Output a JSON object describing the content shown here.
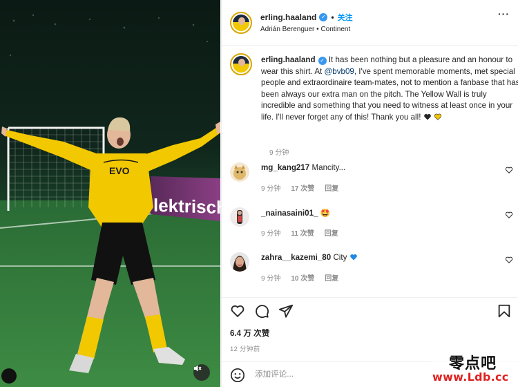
{
  "post": {
    "username": "erling.haaland",
    "follow_label": "关注",
    "dot": "•",
    "subtitle": "Adrián Berenguer • Continent",
    "more": "···"
  },
  "media": {
    "banner_text": "lektrische",
    "shirt_text": "EVO"
  },
  "caption": {
    "username": "erling.haaland",
    "text_before": " It has been nothing but a pleasure and an honour to wear this shirt. At ",
    "mention": "@bvb09",
    "text_after": ", I've spent memorable moments, met special people and extraordinaire team-mates, not to mention a fanbase that has been always our extra man on the pitch. The Yellow Wall is truly incredible and something that you need to witness at least once in your life. I'll never forget any of this! Thank you all! ",
    "time": "9 分钟"
  },
  "comments": [
    {
      "username": "mg_kang217",
      "text": "Mancity...",
      "emoji": "",
      "time": "9 分钟",
      "likes": "17 次赞",
      "reply": "回复"
    },
    {
      "username": "_nainasaini01_",
      "text": "",
      "emoji": "🤩",
      "time": "9 分钟",
      "likes": "11 次赞",
      "reply": "回复"
    },
    {
      "username": "zahra__kazemi_80",
      "text": "City",
      "emoji": "💙",
      "time": "9 分钟",
      "likes": "10 次赞",
      "reply": "回复"
    }
  ],
  "engagement": {
    "likes": "6.4 万 次赞",
    "time_ago": "12 分钟前"
  },
  "composer": {
    "placeholder": "添加评论..."
  },
  "watermark": {
    "cn": "零点吧",
    "url": "www.Ldb.cc"
  },
  "colors": {
    "accent": "#0095f6",
    "verified": "#3897f0",
    "shirt_yellow": "#f2c800"
  }
}
